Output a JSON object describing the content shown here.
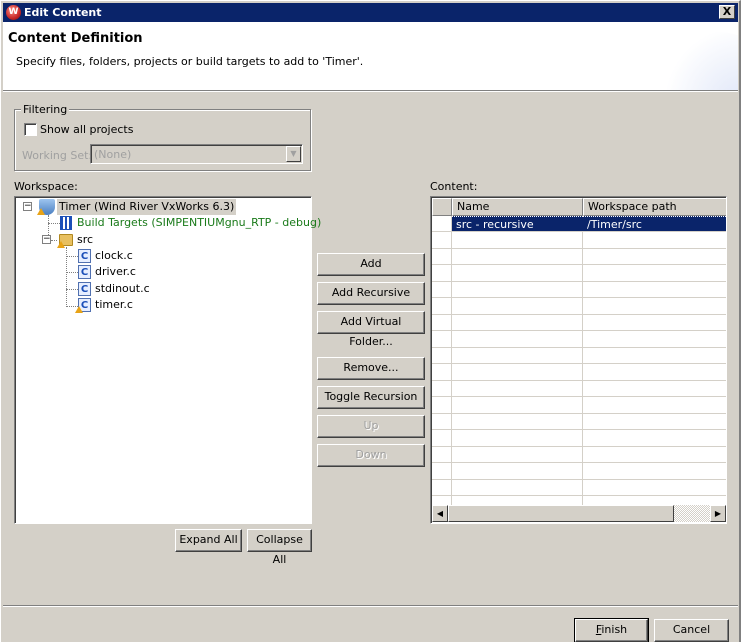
{
  "window": {
    "title": "Edit Content",
    "close_label": "X"
  },
  "banner": {
    "heading": "Content Definition",
    "description": "Specify files, folders, projects or build targets to add to 'Timer'."
  },
  "filtering": {
    "legend": "Filtering",
    "show_all_projects_label": "Show all projects",
    "show_all_projects_checked": false,
    "working_set_label": "Working Set:",
    "working_set_value": "(None)"
  },
  "workspace": {
    "label": "Workspace:",
    "tree": {
      "project": "Timer (Wind River VxWorks 6.3)",
      "build_targets": "Build Targets (SIMPENTIUMgnu_RTP - debug)",
      "folder": "src",
      "files": [
        "clock.c",
        "driver.c",
        "stdinout.c",
        "timer.c"
      ]
    },
    "expand_all": "Expand All",
    "collapse_all": "Collapse All"
  },
  "actions": {
    "add": "Add",
    "add_recursive": "Add Recursive",
    "add_virtual_folder": "Add Virtual Folder...",
    "remove": "Remove...",
    "toggle_recursion": "Toggle Recursion",
    "up": "Up",
    "down": "Down"
  },
  "content": {
    "label": "Content:",
    "columns": [
      "Name",
      "Workspace path"
    ],
    "rows": [
      {
        "name": "src - recursive",
        "path": "/Timer/src",
        "selected": true
      }
    ]
  },
  "footer": {
    "finish_prefix": "F",
    "finish_rest": "inish",
    "cancel": "Cancel"
  },
  "colors": {
    "titlebar": "#0a246a",
    "dialog_bg": "#d4d0c8",
    "build_targets_text": "#1a7a1a",
    "selection": "#0a246a"
  }
}
